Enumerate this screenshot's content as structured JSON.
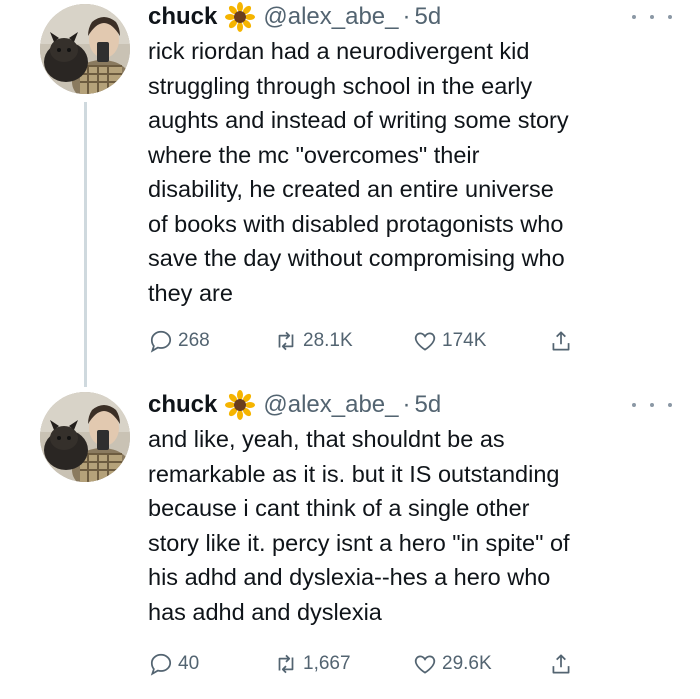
{
  "colors": {
    "text": "#0f1419",
    "secondary": "#536471",
    "thread_line": "#cfd9de"
  },
  "tweets": [
    {
      "name": "chuck",
      "emoji": "sunflower-icon",
      "handle": "@alex_abe_",
      "dot": "·",
      "time": "5d",
      "text": "rick riordan had a neurodivergent kid\nstruggling through school in the early\naughts and instead of writing some story\nwhere the mc \"overcomes\" their\ndisability, he created an entire universe\nof books with disabled protagonists who\nsave the day without compromising who\nthey are",
      "replies": "268",
      "retweets": "28.1K",
      "likes": "174K"
    },
    {
      "name": "chuck",
      "emoji": "sunflower-icon",
      "handle": "@alex_abe_",
      "dot": "·",
      "time": "5d",
      "text": "and like, yeah, that shouldnt be as\nremarkable as it is. but it IS outstanding\nbecause i cant think of a single other\nstory like it. percy isnt a hero \"in spite\" of\nhis adhd and dyslexia--hes a hero who\nhas adhd and dyslexia",
      "replies": "40",
      "retweets": "1,667",
      "likes": "29.6K"
    }
  ]
}
